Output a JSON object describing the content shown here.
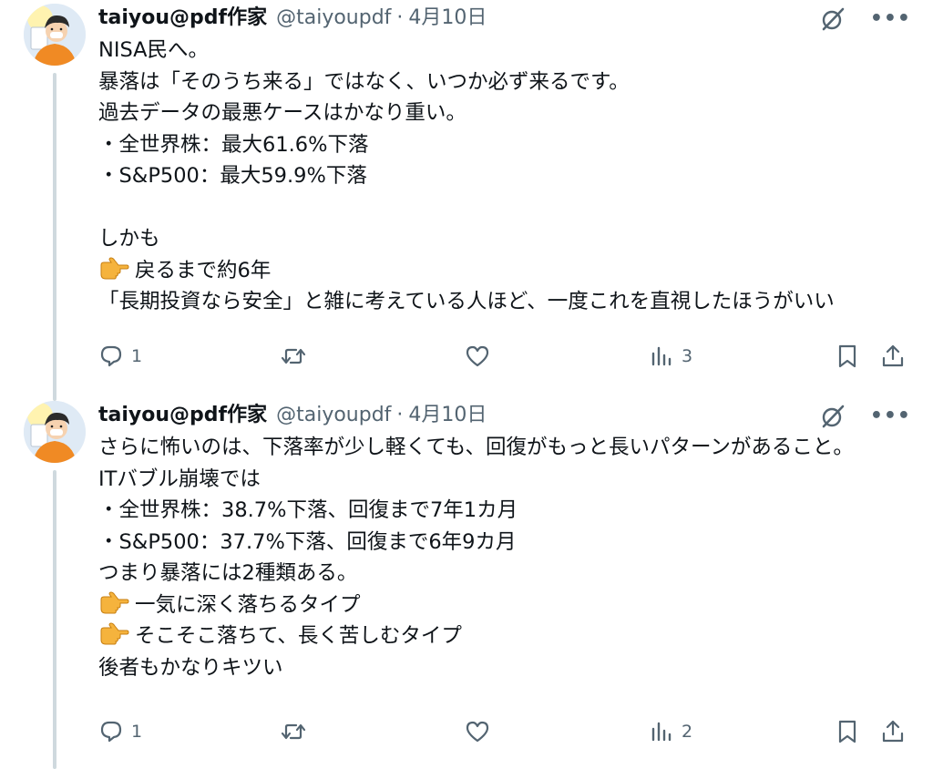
{
  "tweets": [
    {
      "author_name": "taiyou@pdf作家",
      "handle": "@taiyoupdf",
      "separator": "·",
      "date": "4月10日",
      "lines": [
        "NISA民へ。",
        "暴落は「そのうち来る」ではなく、いつか必ず来るです。",
        "過去データの最悪ケースはかなり重い。",
        "・全世界株：最大61.6%下落",
        "・S&P500：最大59.9%下落",
        "",
        "しかも",
        "戻るまで約6年",
        "「長期投資なら安全」と雑に考えている人ほど、一度これを直視したほうがいい"
      ],
      "emoji_lines": [
        7
      ],
      "reply_count": "1",
      "retweet_count": "",
      "like_count": "",
      "view_count": "3"
    },
    {
      "author_name": "taiyou@pdf作家",
      "handle": "@taiyoupdf",
      "separator": "·",
      "date": "4月10日",
      "lines": [
        "さらに怖いのは、下落率が少し軽くても、回復がもっと長いパターンがあること。",
        "ITバブル崩壊では",
        "・全世界株：38.7%下落、回復まで7年1カ月",
        "・S&P500：37.7%下落、回復まで6年9カ月",
        "つまり暴落には2種類ある。",
        "一気に深く落ちるタイプ",
        "そこそこ落ちて、長く苦しむタイプ",
        "後者もかなりキツい"
      ],
      "emoji_lines": [
        5,
        6
      ],
      "reply_count": "1",
      "retweet_count": "",
      "like_count": "",
      "view_count": "2"
    }
  ],
  "icons": {
    "avatar": "avatar-illustration",
    "grok": "grok-icon",
    "more": "more-icon",
    "reply": "reply-icon",
    "retweet": "retweet-icon",
    "like": "heart-icon",
    "views": "views-icon",
    "bookmark": "bookmark-icon",
    "share": "share-icon",
    "pointing": "pointing-right-emoji"
  },
  "colors": {
    "text": "#0f1419",
    "secondary": "#536471",
    "thread_line": "#cfd9de",
    "emoji": "#f5a623"
  }
}
